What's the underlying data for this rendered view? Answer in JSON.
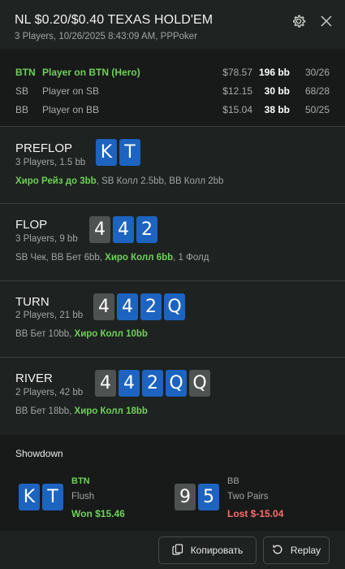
{
  "header": {
    "title": "NL $0.20/$0.40 TEXAS HOLD'EM",
    "subtitle": "3 Players, 10/26/2025 8:43:09 AM, PPPoker",
    "settings_icon": "gear-icon",
    "close_icon": "close-icon"
  },
  "players": [
    {
      "pos": "BTN",
      "name": "Player on BTN (Hero)",
      "stack": "$78.57",
      "bb": "196 bb",
      "stat": "30/26",
      "hero": true
    },
    {
      "pos": "SB",
      "name": "Player on SB",
      "stack": "$12.15",
      "bb": "30 bb",
      "stat": "68/28",
      "hero": false
    },
    {
      "pos": "BB",
      "name": "Player on BB",
      "stack": "$15.04",
      "bb": "38 bb",
      "stat": "50/25",
      "hero": false
    }
  ],
  "streets": {
    "preflop": {
      "name": "PREFLOP",
      "info": "3 Players, 1.5 bb",
      "cards": [
        "K",
        "T"
      ],
      "actions": [
        {
          "text": "Хиро Рейз до 3bb",
          "hero": true
        },
        {
          "text": ", SB Колл 2.5bb, BB Колл 2bb",
          "hero": false
        }
      ]
    },
    "flop": {
      "name": "FLOP",
      "info": "3 Players, 9 bb",
      "cards": [
        "4",
        "4",
        "2"
      ],
      "actions": [
        {
          "text": "SB Чек, BB Бет 6bb, ",
          "hero": false
        },
        {
          "text": "Хиро Колл 6bb",
          "hero": true
        },
        {
          "text": ", 1 Фолд",
          "hero": false
        }
      ]
    },
    "turn": {
      "name": "TURN",
      "info": "2 Players, 21 bb",
      "cards": [
        "4",
        "4",
        "2",
        "Q"
      ],
      "actions": [
        {
          "text": "BB Бет 10bb, ",
          "hero": false
        },
        {
          "text": "Хиро Колл 10bb",
          "hero": true
        }
      ]
    },
    "river": {
      "name": "RIVER",
      "info": "2 Players, 42 bb",
      "cards": [
        "4",
        "4",
        "2",
        "Q",
        "Q"
      ],
      "actions": [
        {
          "text": "BB Бет 18bb, ",
          "hero": false
        },
        {
          "text": "Хиро Колл 18bb",
          "hero": true
        }
      ]
    }
  },
  "showdown": {
    "title": "Showdown",
    "hands": [
      {
        "pos": "BTN",
        "cards": [
          "K",
          "T"
        ],
        "hand": "Flush",
        "result": "Won $15.46",
        "won": true
      },
      {
        "pos": "BB",
        "cards": [
          "9",
          "5"
        ],
        "hand": "Two Pairs",
        "result": "Lost $-15.04",
        "won": false
      }
    ]
  },
  "footer": {
    "copy_label": "Копировать",
    "copy_icon": "copy-icon",
    "replay_label": "Replay",
    "replay_icon": "replay-icon"
  },
  "colors": {
    "background": "#1e2220",
    "panel": "#171a18",
    "hero_green": "#6fd05a",
    "card_blue": "#1d63c0",
    "card_gray": "#4e5250",
    "lost_red": "#ff6b6b"
  }
}
